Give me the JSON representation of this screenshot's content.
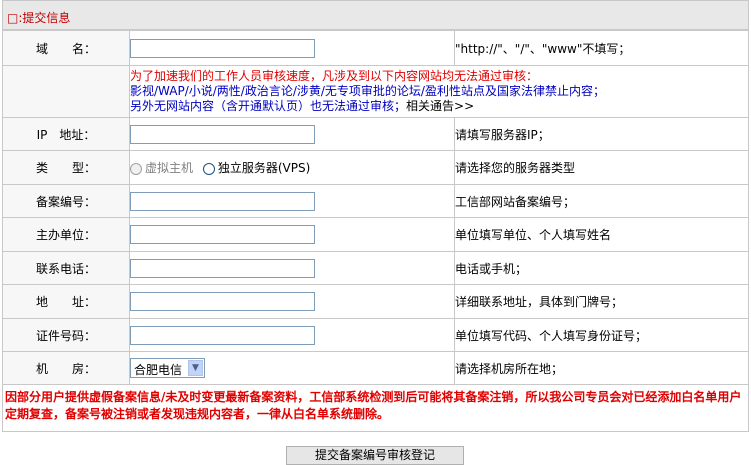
{
  "section_title": "□:提交信息",
  "rows": {
    "domain": {
      "label": "域　　名：",
      "value": "",
      "hint": "\"http://\"、\"/\"、\"www\"不填写；"
    },
    "notice": {
      "line1": "为了加速我们的工作人员审核速度，凡涉及到以下内容网站均无法通过审核：",
      "line2": "影视/WAP/小说/两性/政治言论/涉黄/无专项审批的论坛/盈利性站点及国家法律禁止内容；",
      "line3": "另外无网站内容（含开通默认页）也无法通过审核；",
      "link": "相关通告>>"
    },
    "ip": {
      "label": "IP　地址：",
      "value": "",
      "hint": "请填写服务器IP；"
    },
    "type": {
      "label": "类　　型：",
      "option1": "虚拟主机",
      "option2": "独立服务器(VPS)",
      "hint": "请选择您的服务器类型"
    },
    "record_no": {
      "label": "备案编号：",
      "value": "",
      "hint": "工信部网站备案编号；"
    },
    "sponsor": {
      "label": "主办单位：",
      "value": "",
      "hint": "单位填写单位、个人填写姓名"
    },
    "phone": {
      "label": "联系电话：",
      "value": "",
      "hint": "电话或手机；"
    },
    "address": {
      "label": "地　　址：",
      "value": "",
      "hint": "详细联系地址，具体到门牌号；"
    },
    "cert": {
      "label": "证件号码：",
      "value": "",
      "hint": "单位填写代码、个人填写身份证号；"
    },
    "room": {
      "label": "机　　房：",
      "selected": "合肥电信",
      "hint": "请选择机房所在地；"
    }
  },
  "warning": "因部分用户提供虚假备案信息/未及时变更最新备案资料，工信部系统检测到后可能将其备案注销，所以我公司专员会对已经添加白名单用户定期复查，备案号被注销或者发现违规内容者，一律从白名单系统删除。",
  "submit_label": "提交备案编号审核登记"
}
